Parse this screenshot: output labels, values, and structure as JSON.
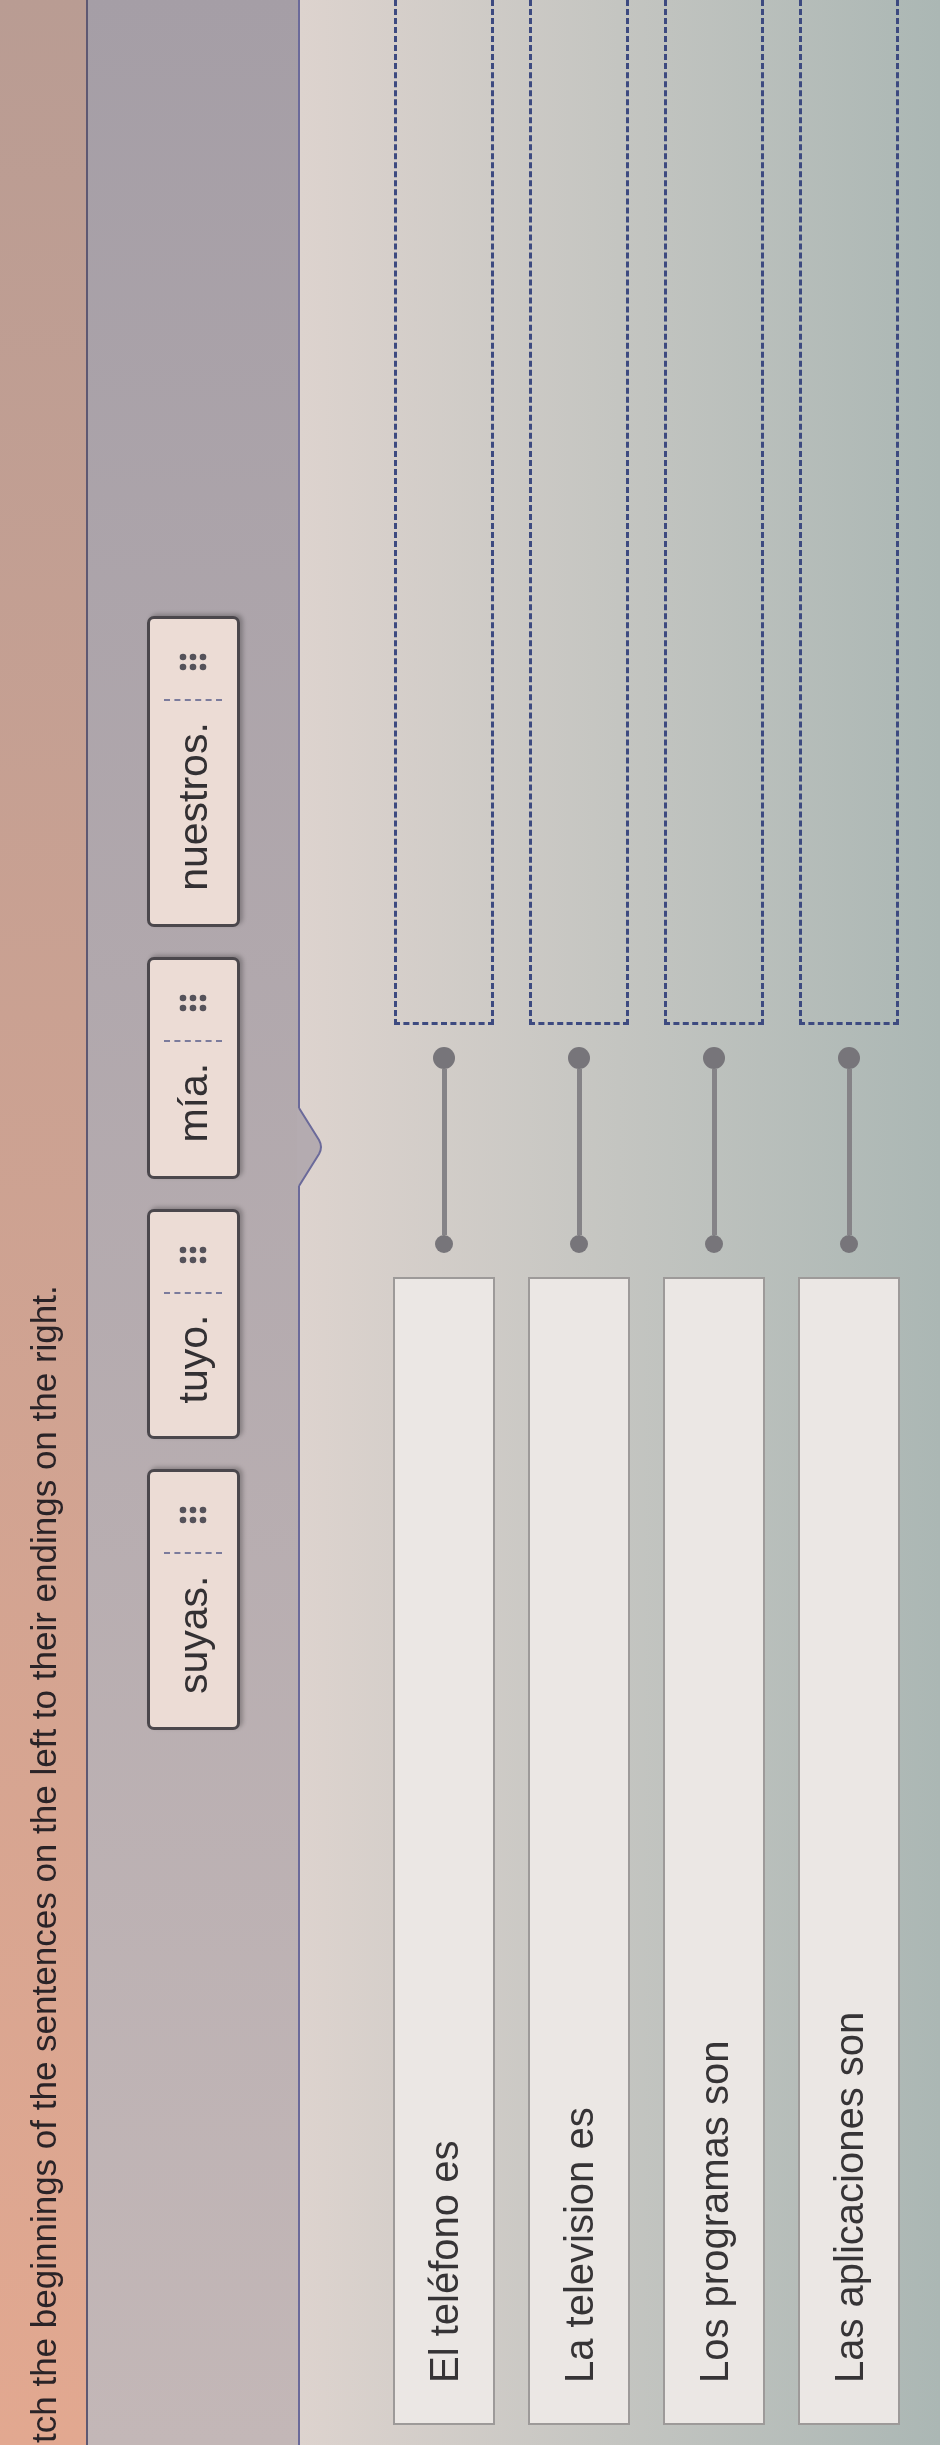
{
  "instruction": "tch the beginnings of the sentences on the left to their endings on the right.",
  "answer_bank": [
    {
      "text": "suyas."
    },
    {
      "text": "tuyo."
    },
    {
      "text": "mía."
    },
    {
      "text": "nuestros."
    }
  ],
  "rows": [
    {
      "beginning": "El teléfono es"
    },
    {
      "beginning": "La television es"
    },
    {
      "beginning": "Los programas son"
    },
    {
      "beginning": "Las aplicaciones son"
    }
  ]
}
